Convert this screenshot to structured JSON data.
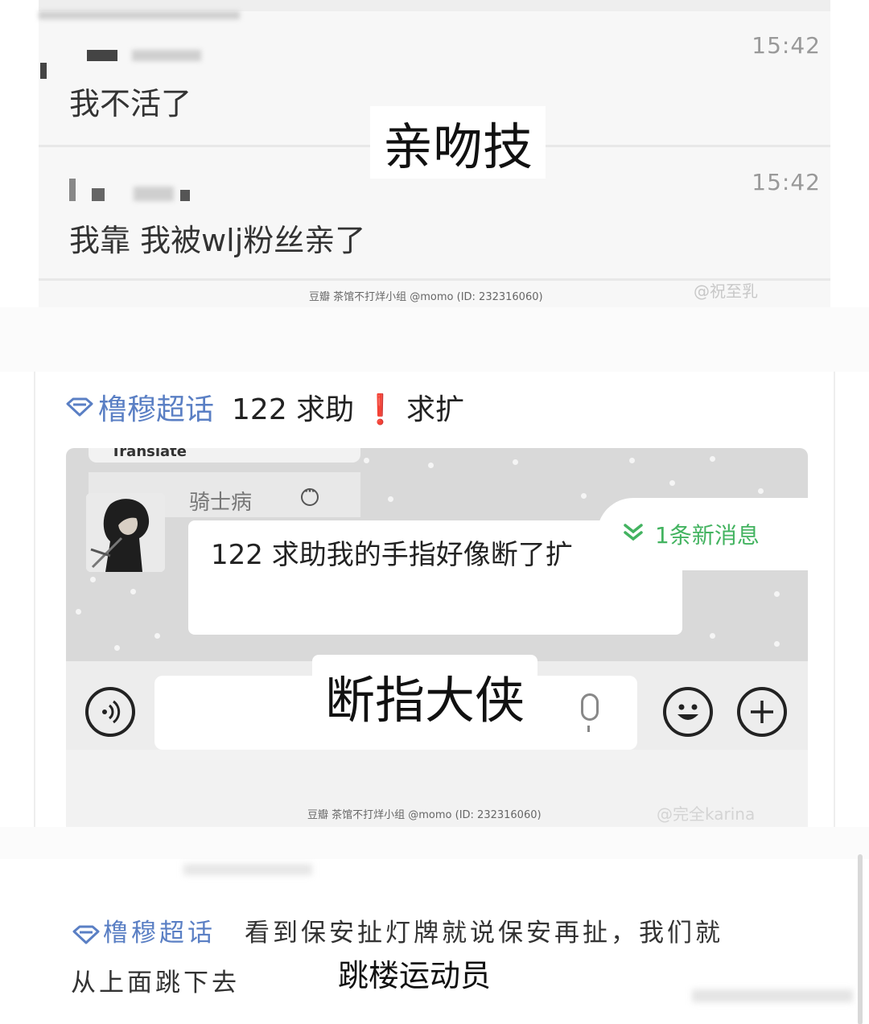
{
  "panel1": {
    "messages": [
      {
        "time": "15:42",
        "text": "我不活了"
      },
      {
        "time": "15:42",
        "text": "我靠 我被wlj粉丝亲了"
      }
    ],
    "caption": "亲吻技",
    "watermark": "豆瓣 茶馆不打烊小组 @momo (ID: 232316060)",
    "weibo": "@祝至乳"
  },
  "panel2": {
    "topic_tag": "橹穆超话",
    "topic_text": "122 求助",
    "topic_excl": "❗",
    "topic_text2": "求扩",
    "chat": {
      "translate": "Translate",
      "sender": "骑士病",
      "message": "122 求助我的手指好像断了扩",
      "new_messages": "1条新消息"
    },
    "caption": "断指大侠",
    "watermark": "豆瓣 茶馆不打烊小组 @momo (ID: 232316060)",
    "weibo": "@完全karina"
  },
  "panel3": {
    "topic_tag": "橹穆超话",
    "text_line1": "看到保安扯灯牌就说保安再扯，我们就",
    "text_line2": "从上面跳下去",
    "caption": "跳楼运动员"
  },
  "colors": {
    "topic_blue": "#5a7fc4",
    "new_msg_green": "#43b360",
    "alert_red": "#e0242a"
  }
}
